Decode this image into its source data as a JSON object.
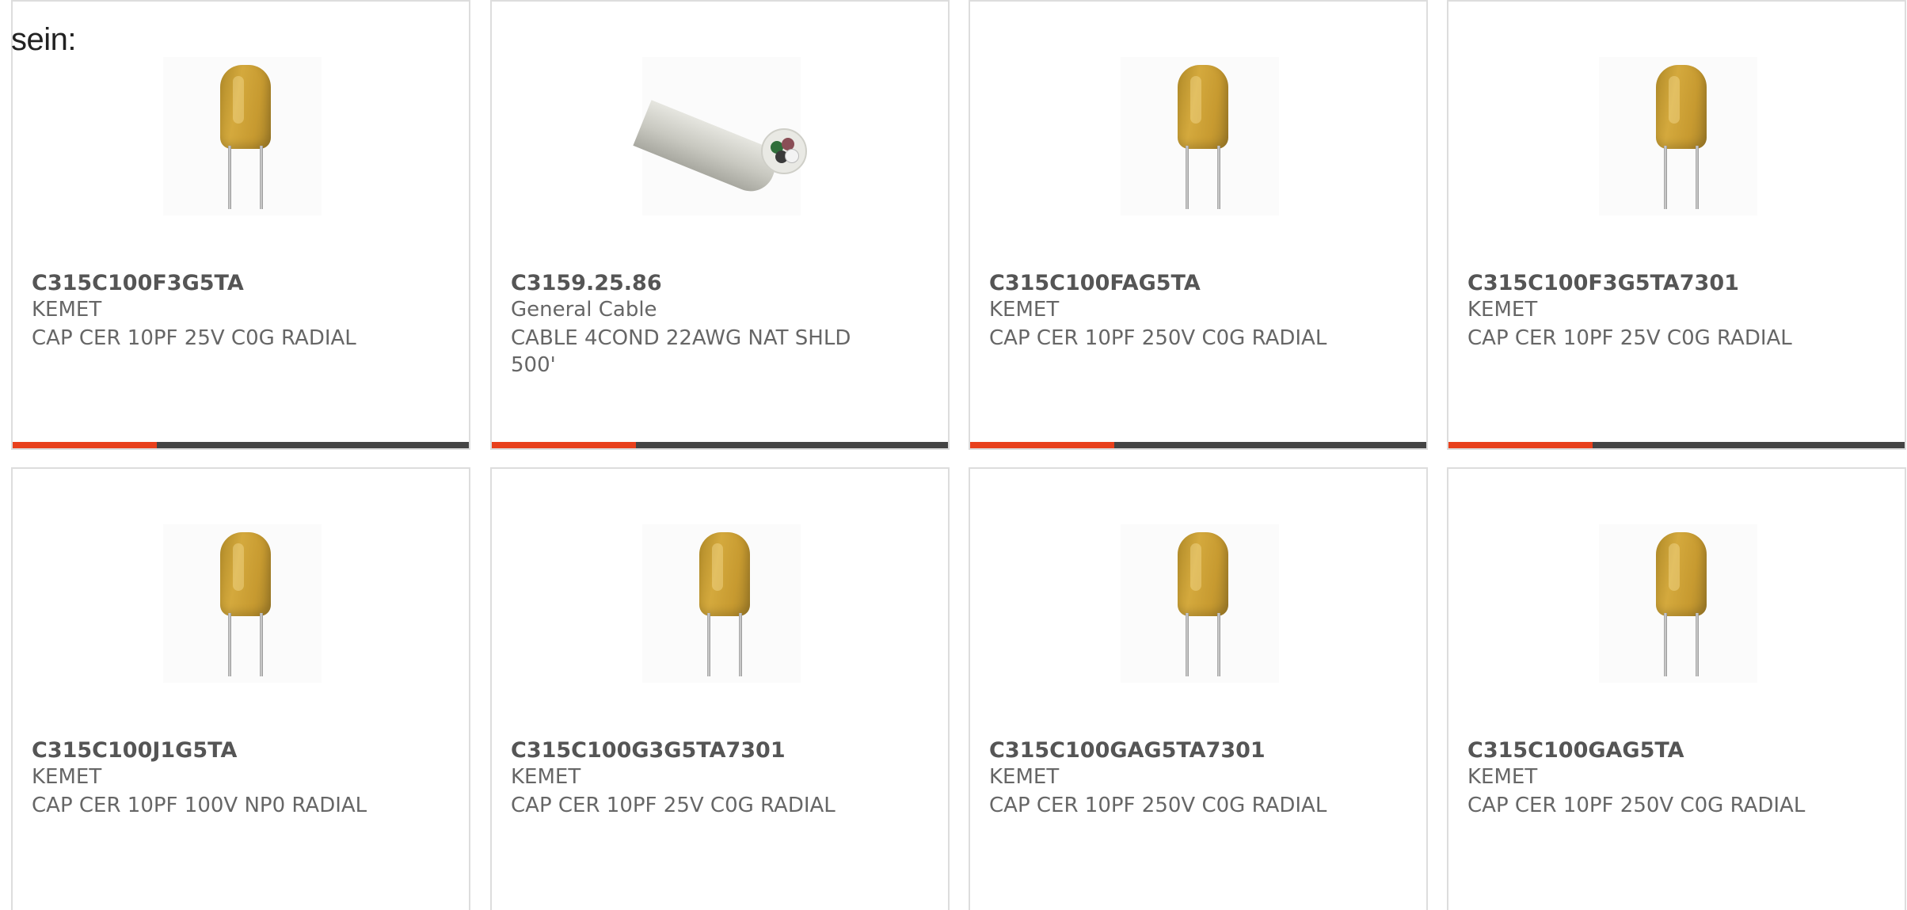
{
  "intro_text": "sein:",
  "colors": {
    "accent": "#e8401c",
    "bar": "#444444",
    "text": "#666666",
    "part_number": "#555555"
  },
  "products": [
    {
      "part_number": "C315C100F3G5TA",
      "manufacturer": "KEMET",
      "description": "CAP CER 10PF 25V C0G RADIAL",
      "image": "capacitor-image"
    },
    {
      "part_number": "C3159.25.86",
      "manufacturer": "General Cable",
      "description": "CABLE 4COND 22AWG NAT SHLD 500'",
      "image": "cable-image"
    },
    {
      "part_number": "C315C100FAG5TA",
      "manufacturer": "KEMET",
      "description": "CAP CER 10PF 250V C0G RADIAL",
      "image": "capacitor-image"
    },
    {
      "part_number": "C315C100F3G5TA7301",
      "manufacturer": "KEMET",
      "description": "CAP CER 10PF 25V C0G RADIAL",
      "image": "capacitor-image"
    },
    {
      "part_number": "C315C100J1G5TA",
      "manufacturer": "KEMET",
      "description": "CAP CER 10PF 100V NP0 RADIAL",
      "image": "capacitor-image"
    },
    {
      "part_number": "C315C100G3G5TA7301",
      "manufacturer": "KEMET",
      "description": "CAP CER 10PF 25V C0G RADIAL",
      "image": "capacitor-image"
    },
    {
      "part_number": "C315C100GAG5TA7301",
      "manufacturer": "KEMET",
      "description": "CAP CER 10PF 250V C0G RADIAL",
      "image": "capacitor-image"
    },
    {
      "part_number": "C315C100GAG5TA",
      "manufacturer": "KEMET",
      "description": "CAP CER 10PF 250V C0G RADIAL",
      "image": "capacitor-image"
    }
  ]
}
